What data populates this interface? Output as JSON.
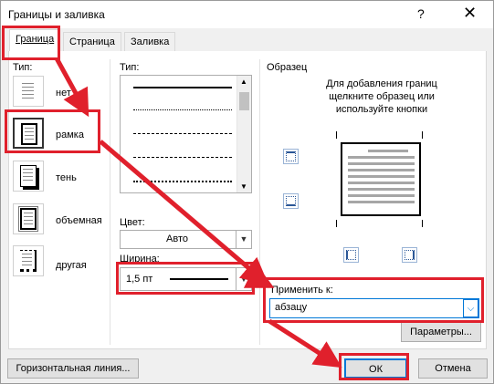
{
  "window": {
    "title": "Границы и заливка",
    "help_label": "?",
    "close_label": "✕"
  },
  "tabs": [
    {
      "label": "Граница",
      "active": true
    },
    {
      "label": "Страница",
      "active": false
    },
    {
      "label": "Заливка",
      "active": false
    }
  ],
  "setting": {
    "label": "Тип:",
    "items": [
      {
        "label": "нет",
        "icon": "none-border-icon",
        "selected": false
      },
      {
        "label": "рамка",
        "icon": "box-border-icon",
        "selected": true
      },
      {
        "label": "тень",
        "icon": "shadow-border-icon",
        "selected": false
      },
      {
        "label": "объемная",
        "icon": "3d-border-icon",
        "selected": false
      },
      {
        "label": "другая",
        "icon": "custom-border-icon",
        "selected": false
      }
    ]
  },
  "style": {
    "label": "Тип:",
    "line_styles": [
      "solid",
      "dotted",
      "dashed-small",
      "dashed",
      "dash-dot"
    ],
    "color_label": "Цвет:",
    "color_value": "Авто",
    "width_label": "Ширина:",
    "width_value": "1,5 пт"
  },
  "preview": {
    "label": "Образец",
    "hint": "Для добавления границ щелкните образец или используйте кнопки"
  },
  "apply_to": {
    "label": "Применить к:",
    "value": "абзацу"
  },
  "buttons": {
    "params": "Параметры...",
    "horizontal_line": "Горизонтальная линия...",
    "ok": "ОК",
    "cancel": "Отмена"
  },
  "annotation_color": "#e0202c"
}
